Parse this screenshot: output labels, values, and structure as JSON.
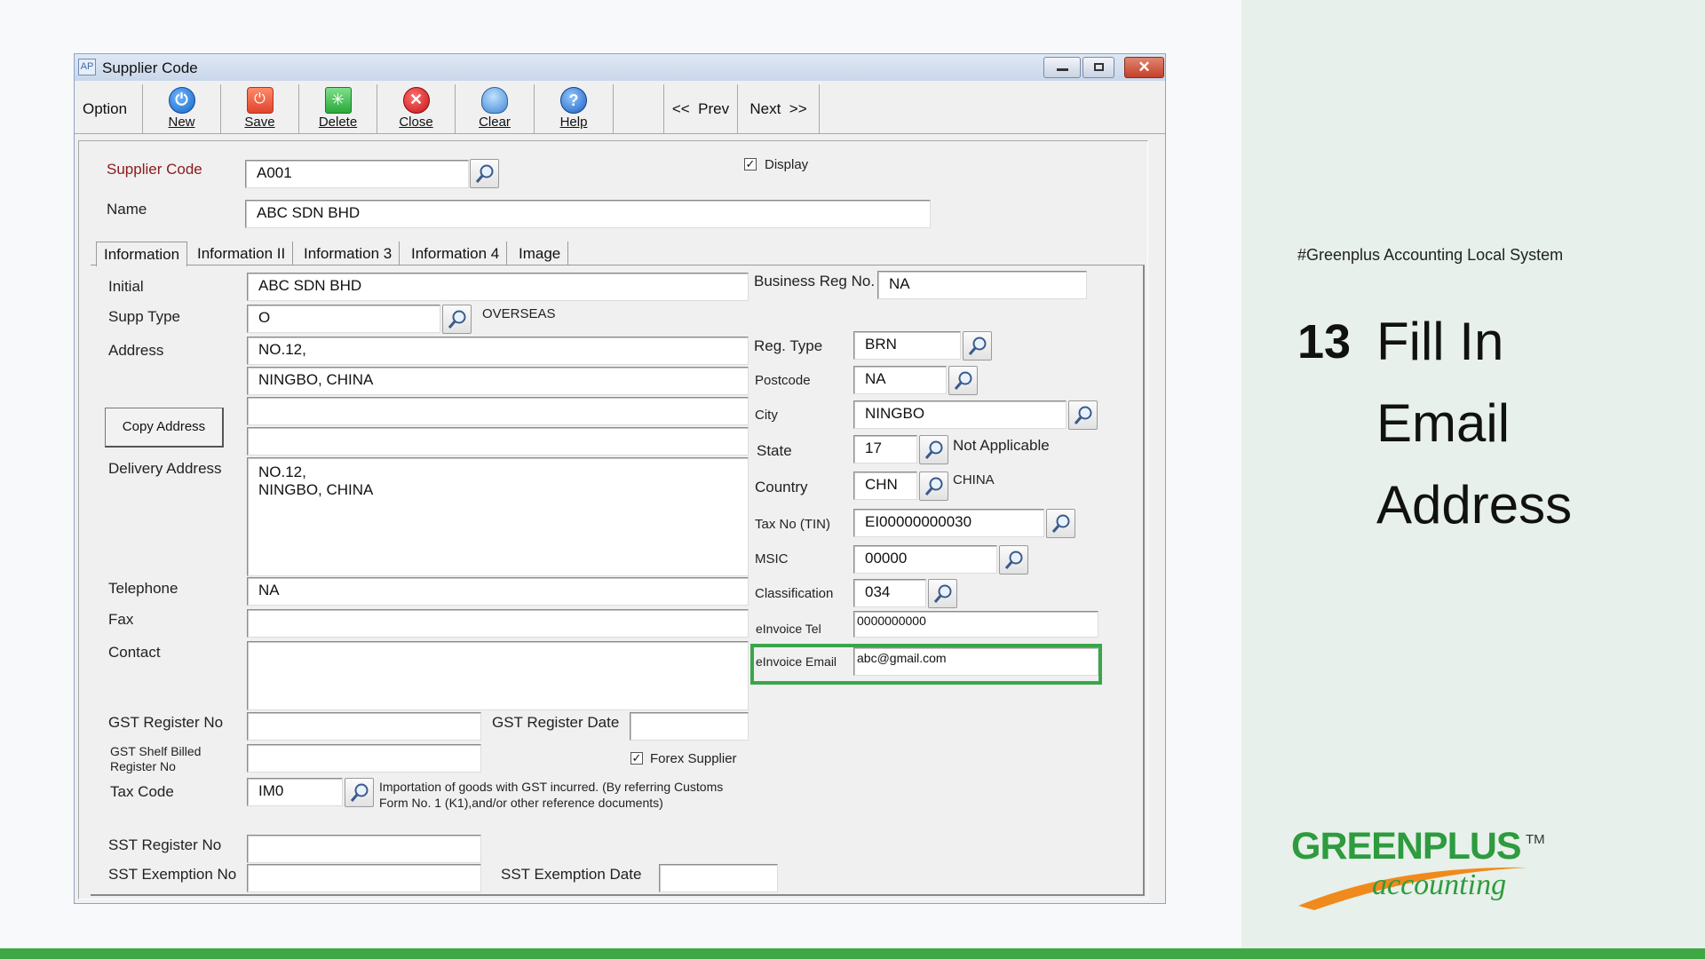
{
  "window": {
    "title": "Supplier Code",
    "icon_text": "AP"
  },
  "toolbar": {
    "option": "Option",
    "new": "New",
    "save": "Save",
    "delete": "Delete",
    "close": "Close",
    "clear": "Clear",
    "help": "Help",
    "prev": "<<  Prev",
    "next": "Next  >>"
  },
  "header": {
    "supplier_code_label": "Supplier Code",
    "supplier_code": "A001",
    "display_label": "Display",
    "name_label": "Name",
    "name": "ABC SDN BHD"
  },
  "tabs": [
    "Information",
    "Information II",
    "Information 3",
    "Information 4",
    "Image"
  ],
  "info": {
    "initial_label": "Initial",
    "initial": "ABC SDN BHD",
    "supp_type_label": "Supp Type",
    "supp_type": "O",
    "supp_type_desc": "OVERSEAS",
    "address_label": "Address",
    "address1": "NO.12,",
    "address2": "NINGBO, CHINA",
    "address3": "",
    "address4": "",
    "copy_address": "Copy Address",
    "delivery_label": "Delivery Address",
    "delivery1": "NO.12,",
    "delivery2": "NINGBO, CHINA",
    "telephone_label": "Telephone",
    "telephone": "NA",
    "fax_label": "Fax",
    "fax": "",
    "contact_label": "Contact",
    "contact": "",
    "gst_reg_no_label": "GST Register No",
    "gst_reg_date_label": "GST Register Date",
    "gst_shelf_label1": "GST Shelf Billed",
    "gst_shelf_label2": "Register No",
    "forex_label": "Forex Supplier",
    "tax_code_label": "Tax Code",
    "tax_code": "IM0",
    "tax_desc1": "Importation of goods with GST incurred. (By referring Customs",
    "tax_desc2": "Form No. 1 (K1),and/or other reference documents)",
    "sst_reg_label": "SST Register No",
    "sst_exempt_no_label": "SST Exemption No",
    "sst_exempt_date_label": "SST Exemption Date",
    "brn_label": "Business Reg No.",
    "brn": "NA",
    "reg_type_label": "Reg. Type",
    "reg_type": "BRN",
    "postcode_label": "Postcode",
    "postcode": "NA",
    "city_label": "City",
    "city": "NINGBO",
    "state_label": "State",
    "state": "17",
    "state_desc": "Not Applicable",
    "country_label": "Country",
    "country": "CHN",
    "country_desc": "CHINA",
    "tin_label": "Tax No (TIN)",
    "tin": "EI00000000030",
    "msic_label": "MSIC",
    "msic": "00000",
    "class_label": "Classification",
    "class": "034",
    "etel_label": "eInvoice Tel",
    "etel": "0000000000",
    "email_label": "eInvoice Email",
    "email": "abc@gmail.com"
  },
  "slide": {
    "hashtag": "#Greenplus Accounting Local System",
    "step": "13",
    "title1": "Fill In",
    "title2": "Email",
    "title3": "Address",
    "logo1": "GREENPLUS",
    "logo_tm": "TM",
    "logo2": "accounting"
  },
  "colors": {
    "accent_green": "#3fa845",
    "highlight_border": "#3aa64a",
    "label_red": "#8b1a1a",
    "logo_orange": "#f08a1c",
    "panel_bg": "#e7f0ea"
  }
}
